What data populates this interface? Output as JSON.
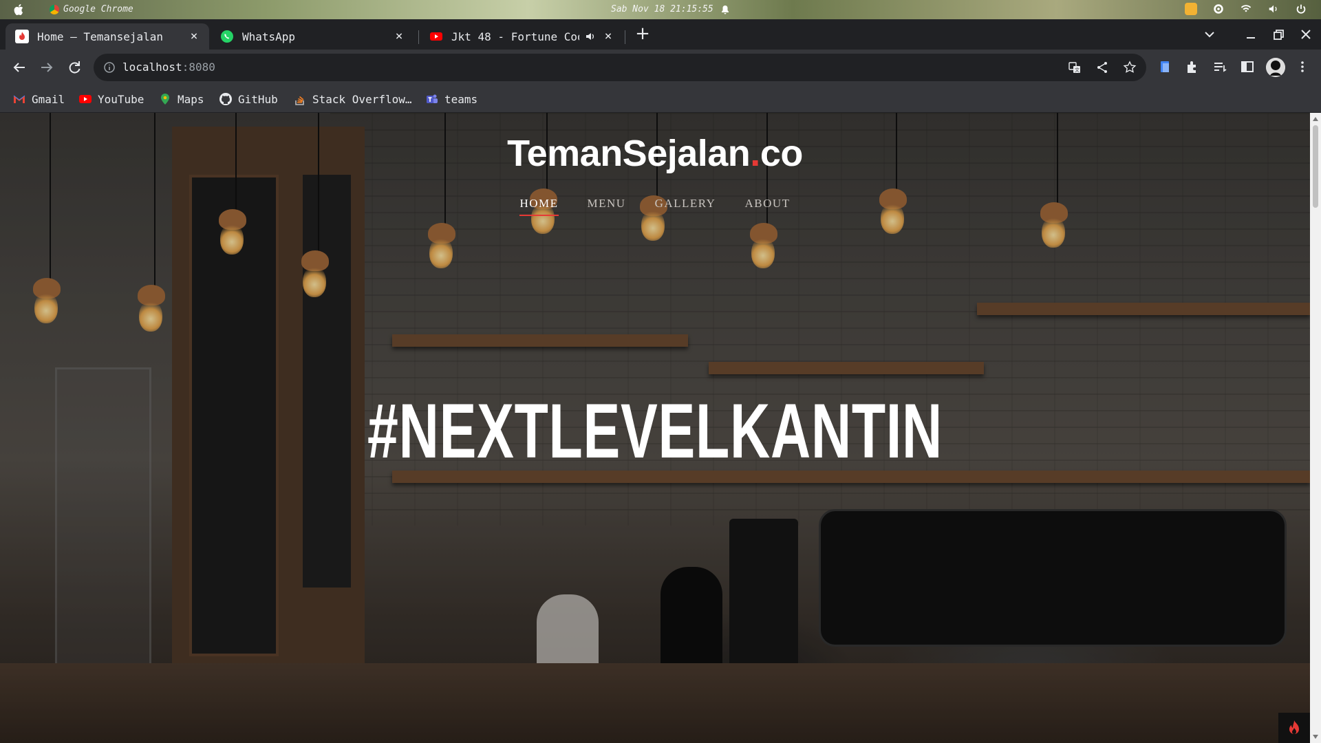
{
  "system_bar": {
    "app_name": "Google Chrome",
    "clock": "Sab Nov 18 21:15:55"
  },
  "tabs": [
    {
      "title": "Home – Temansejalan",
      "favicon": "flame-icon",
      "active": true
    },
    {
      "title": "WhatsApp",
      "favicon": "whatsapp-icon",
      "active": false
    },
    {
      "title": "Jkt 48 - Fortune Coo",
      "favicon": "youtube-icon",
      "active": false,
      "audio": true
    }
  ],
  "address_bar": {
    "host": "localhost",
    "port": ":8080"
  },
  "bookmarks": [
    {
      "label": "Gmail",
      "icon": "gmail-icon"
    },
    {
      "label": "YouTube",
      "icon": "youtube-icon"
    },
    {
      "label": "Maps",
      "icon": "maps-icon"
    },
    {
      "label": "GitHub",
      "icon": "github-icon"
    },
    {
      "label": "Stack Overflow…",
      "icon": "stackoverflow-icon"
    },
    {
      "label": "teams",
      "icon": "teams-icon"
    }
  ],
  "page": {
    "brand_main": "TemanSejalan",
    "brand_dot": ".",
    "brand_tld": "co",
    "nav": [
      "HOME",
      "MENU",
      "GALLERY",
      "ABOUT"
    ],
    "active_nav": "HOME",
    "hero_title": "#NEXTLEVELKANTIN"
  },
  "colors": {
    "accent": "#e53935",
    "chrome_dark": "#202124",
    "chrome_toolbar": "#35363a"
  }
}
